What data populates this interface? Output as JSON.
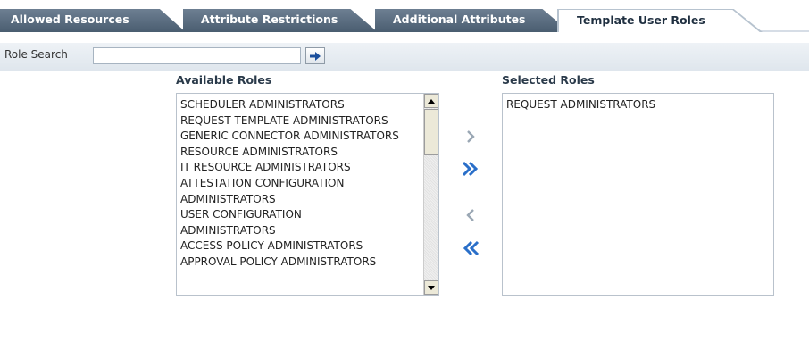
{
  "tabs": [
    {
      "label": "Allowed Resources",
      "active": false
    },
    {
      "label": "Attribute Restrictions",
      "active": false
    },
    {
      "label": "Additional Attributes",
      "active": false
    },
    {
      "label": "Template User Roles",
      "active": true
    }
  ],
  "search": {
    "label": "Role Search",
    "value": "",
    "go_icon": "arrow-right-icon"
  },
  "available": {
    "header": "Available Roles",
    "items": [
      "SCHEDULER ADMINISTRATORS",
      "REQUEST TEMPLATE ADMINISTRATORS",
      "GENERIC CONNECTOR ADMINISTRATORS",
      "RESOURCE ADMINISTRATORS",
      "IT RESOURCE ADMINISTRATORS",
      "ATTESTATION CONFIGURATION ADMINISTRATORS",
      "USER CONFIGURATION ADMINISTRATORS",
      "ACCESS POLICY ADMINISTRATORS",
      "APPROVAL POLICY ADMINISTRATORS"
    ]
  },
  "selected": {
    "header": "Selected Roles",
    "items": [
      "REQUEST ADMINISTRATORS"
    ]
  },
  "shuttle": {
    "move": "chevron-right-icon",
    "move_all": "double-chevron-right-icon",
    "remove": "chevron-left-icon",
    "remove_all": "double-chevron-left-icon"
  },
  "colors": {
    "tab_inactive": "#4f6276",
    "accent_arrow": "#2a6fc9",
    "searchbar_bg": "#e6ebf0"
  }
}
